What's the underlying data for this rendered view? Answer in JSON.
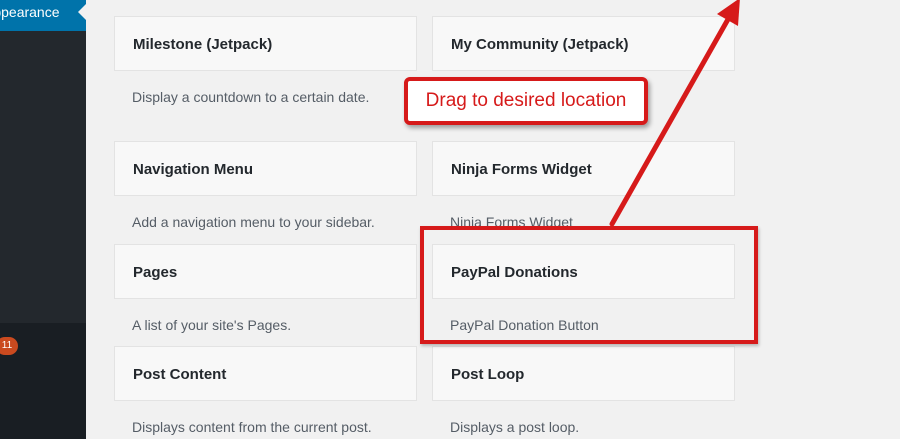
{
  "sidebar": {
    "current_menu_label": "Appearance",
    "update_count": "11"
  },
  "widgets": [
    {
      "title": "Milestone (Jetpack)",
      "description": "Display a countdown to a certain date."
    },
    {
      "title": "My Community (Jetpack)",
      "description": ""
    },
    {
      "title": "Navigation Menu",
      "description": "Add a navigation menu to your sidebar."
    },
    {
      "title": "Ninja Forms Widget",
      "description": "Ninja Forms Widget"
    },
    {
      "title": "Pages",
      "description": "A list of your site's Pages."
    },
    {
      "title": "PayPal Donations",
      "description": "PayPal Donation Button"
    },
    {
      "title": "Post Content",
      "description": "Displays content from the current post."
    },
    {
      "title": "Post Loop",
      "description": "Displays a post loop."
    }
  ],
  "annotation": {
    "callout_text": "Drag to desired location",
    "color": "#d61a1a"
  },
  "colors": {
    "admin_sidebar": "#23282d",
    "active_menu": "#0073aa",
    "badge": "#ca4a1f"
  }
}
